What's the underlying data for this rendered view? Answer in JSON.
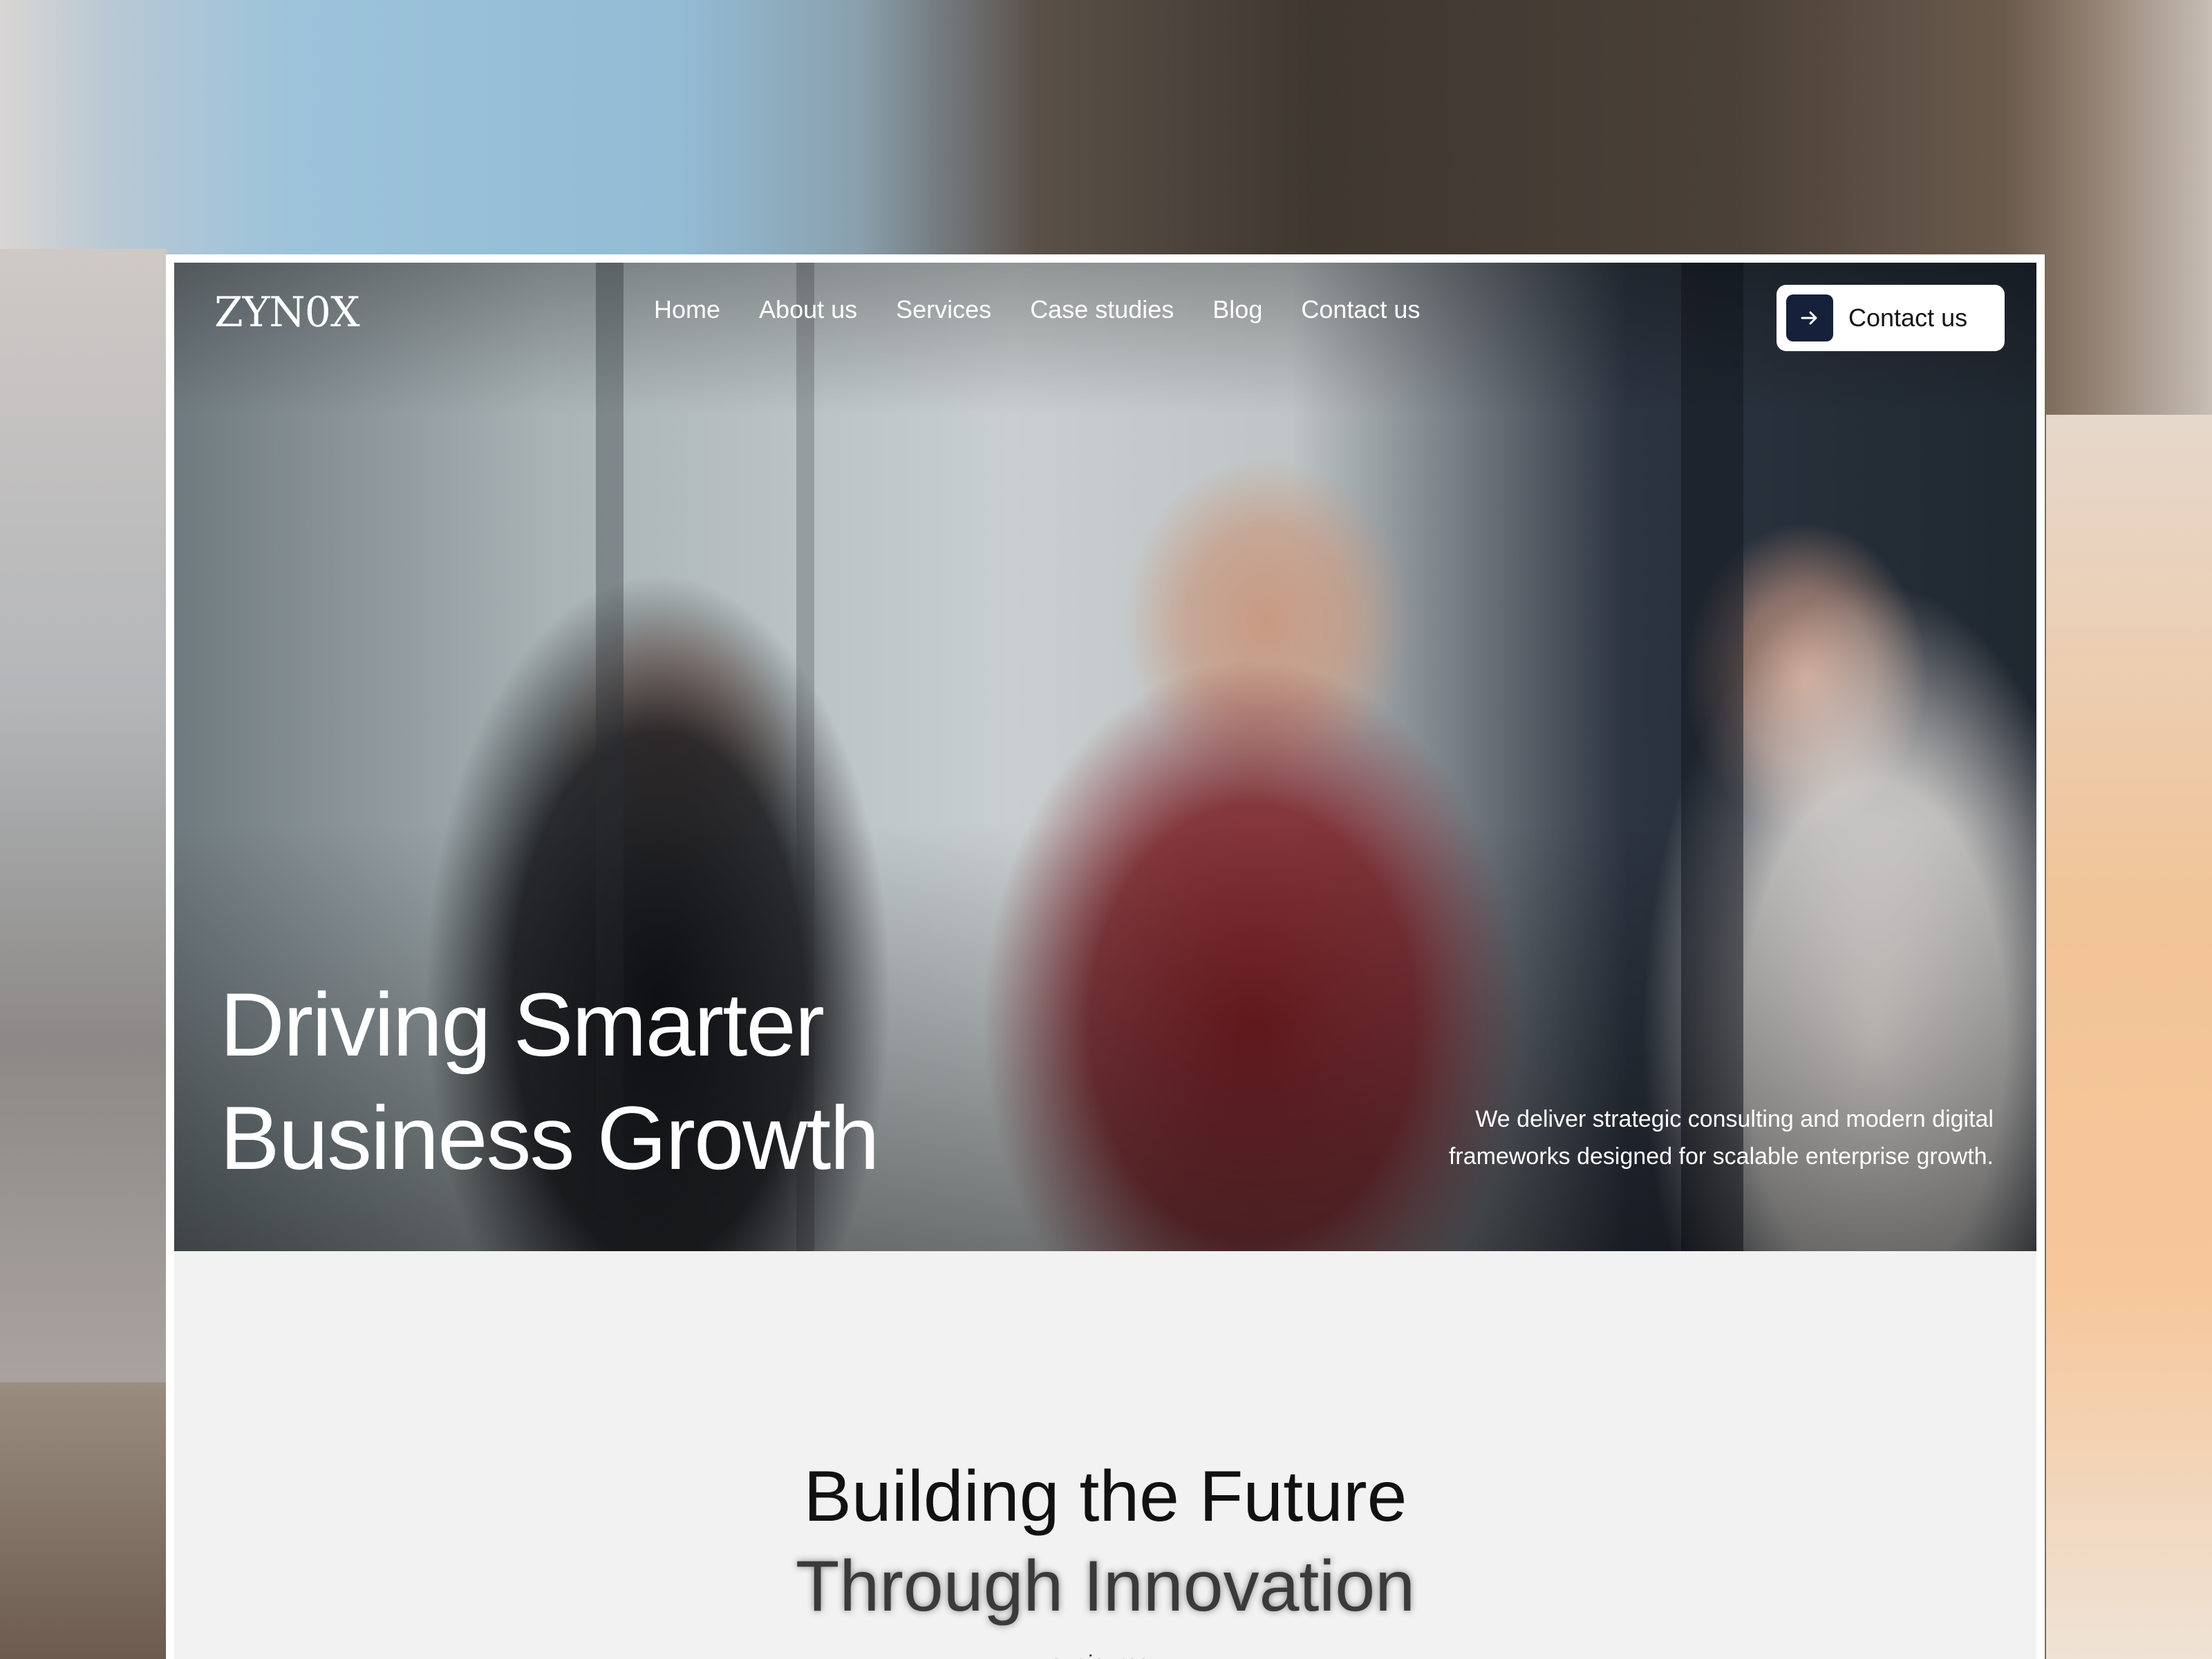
{
  "brand": {
    "logo": "ZYN0X"
  },
  "nav": {
    "items": [
      {
        "label": "Home"
      },
      {
        "label": "About us"
      },
      {
        "label": "Services"
      },
      {
        "label": "Case studies"
      },
      {
        "label": "Blog"
      },
      {
        "label": "Contact us"
      }
    ],
    "cta_label": "Contact us",
    "cta_icon": "arrow-right-icon"
  },
  "hero": {
    "title_line1": "Driving Smarter",
    "title_line2": "Business Growth",
    "subtitle_line1": "We deliver strategic consulting and modern digital",
    "subtitle_line2": "frameworks designed for scalable enterprise growth."
  },
  "journey": {
    "eyebrow": "our journey",
    "title_line1": "Building the Future",
    "title_line2": "Through Innovation"
  },
  "colors": {
    "cta_icon_bg": "#15203a",
    "section_bg": "#f2f2f2",
    "text_dark": "#111111"
  }
}
